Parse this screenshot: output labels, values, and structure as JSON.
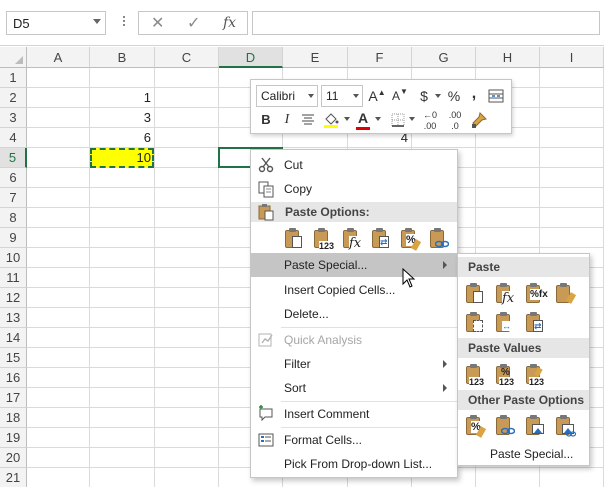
{
  "formula_bar": {
    "name_box": "D5",
    "cancel_glyph": "✕",
    "enter_glyph": "✓",
    "fx_glyph": "fx",
    "formula_value": ""
  },
  "grid": {
    "columns": [
      "A",
      "B",
      "C",
      "D",
      "E",
      "F",
      "G",
      "H",
      "I"
    ],
    "rows": [
      "1",
      "2",
      "3",
      "4",
      "5",
      "6",
      "7",
      "8",
      "9",
      "10",
      "11",
      "12",
      "13",
      "14",
      "15",
      "16",
      "17",
      "18",
      "19",
      "20",
      "21"
    ],
    "selected_column": "D",
    "selected_row": "5",
    "cells": {
      "B2": "1",
      "B3": "3",
      "B4": "6",
      "B5": "10",
      "F4": "4"
    },
    "highlight_color": "#ffff00",
    "accent_color": "#217346"
  },
  "mini_toolbar": {
    "font_name": "Calibri",
    "font_size": "11",
    "increase_font": "A",
    "decrease_font": "A",
    "currency": "$",
    "percent": "%",
    "comma": ",",
    "bold": "B",
    "italic": "I",
    "font_color": "A",
    "font_color_hex": "#e00000",
    "fill_color_hex": "#ffff00",
    "inc_decimal": ".00",
    "dec_decimal": ".0"
  },
  "context_menu": {
    "items": {
      "cut": "Cut",
      "copy": "Copy",
      "paste_options": "Paste Options:",
      "paste_special": "Paste Special...",
      "insert_copied_cells": "Insert Copied Cells...",
      "delete": "Delete...",
      "quick_analysis": "Quick Analysis",
      "filter": "Filter",
      "sort": "Sort",
      "insert_comment": "Insert Comment",
      "format_cells": "Format Cells...",
      "pick_from_list": "Pick From Drop-down List..."
    },
    "paste_option_icons": [
      "paste-icon",
      "paste-values-icon",
      "paste-formulas-icon",
      "paste-transpose-icon",
      "paste-formatting-icon",
      "paste-link-icon"
    ]
  },
  "submenu": {
    "paste_header": "Paste",
    "paste_values_header": "Paste Values",
    "other_paste_header": "Other Paste Options",
    "paste_special": "Paste Special..."
  }
}
